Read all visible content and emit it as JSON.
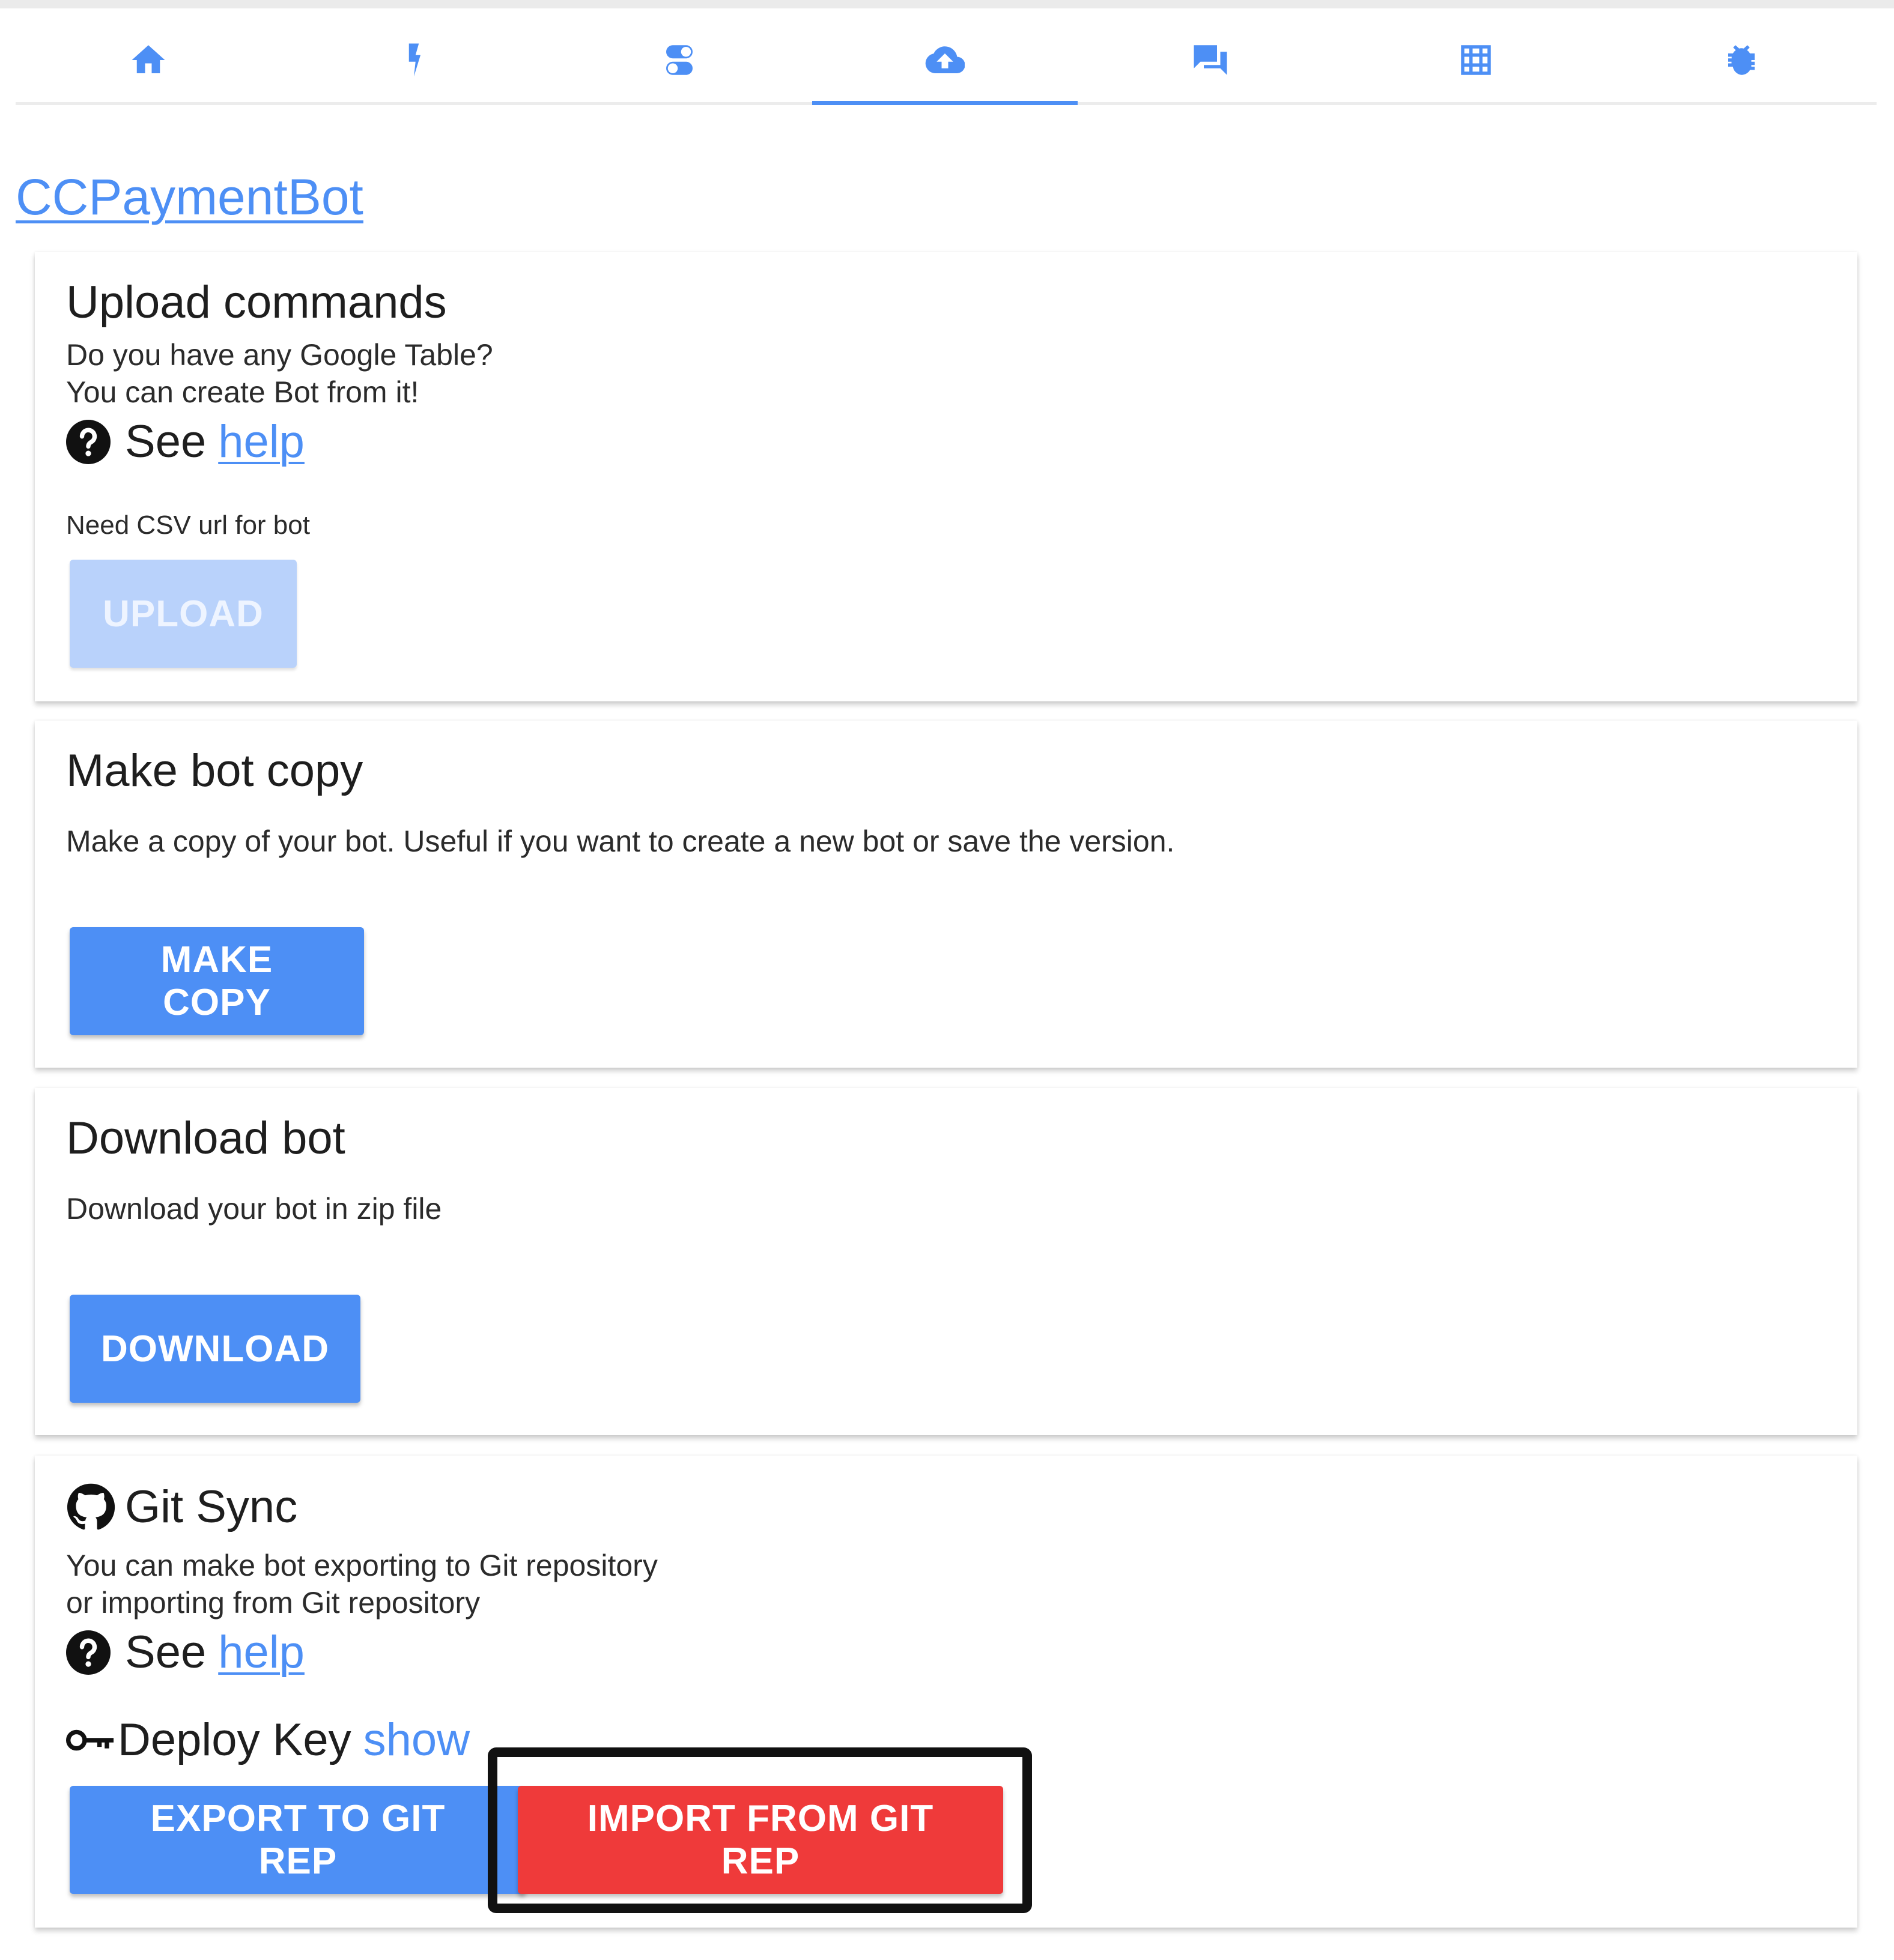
{
  "nav": {
    "tabs": [
      {
        "icon": "home-icon",
        "active": false
      },
      {
        "icon": "bolt-icon",
        "active": false
      },
      {
        "icon": "toggle-icon",
        "active": false
      },
      {
        "icon": "cloud-upload-icon",
        "active": true
      },
      {
        "icon": "chat-icon",
        "active": false
      },
      {
        "icon": "grid-icon",
        "active": false
      },
      {
        "icon": "bug-icon",
        "active": false
      }
    ]
  },
  "bot_name": "CCPaymentBot",
  "upload_card": {
    "title": "Upload commands",
    "desc_line1": "Do you have any Google Table?",
    "desc_line2": "You can create Bot from it!",
    "see_text": "See",
    "help_link": "help",
    "hint": "Need CSV url for bot",
    "button": "UPLOAD"
  },
  "copy_card": {
    "title": "Make bot copy",
    "desc": "Make a copy of your bot. Useful if you want to create a new bot or save the version.",
    "button": "MAKE COPY"
  },
  "download_card": {
    "title": "Download bot",
    "desc": "Download your bot in zip file",
    "button": "DOWNLOAD"
  },
  "git_card": {
    "title": "Git Sync",
    "desc_line1": "You can make bot exporting to Git repository",
    "desc_line2": "or importing from Git repository",
    "see_text": "See",
    "help_link": "help",
    "deploy_label": "Deploy Key",
    "deploy_show": "show",
    "export_button": "EXPORT TO GIT REP",
    "import_button": "IMPORT FROM GIT REP"
  },
  "colors": {
    "accent": "#4d8ff5",
    "disabled": "#b9d2fb",
    "danger": "#ef3a3a",
    "highlight_frame": "#111111"
  }
}
